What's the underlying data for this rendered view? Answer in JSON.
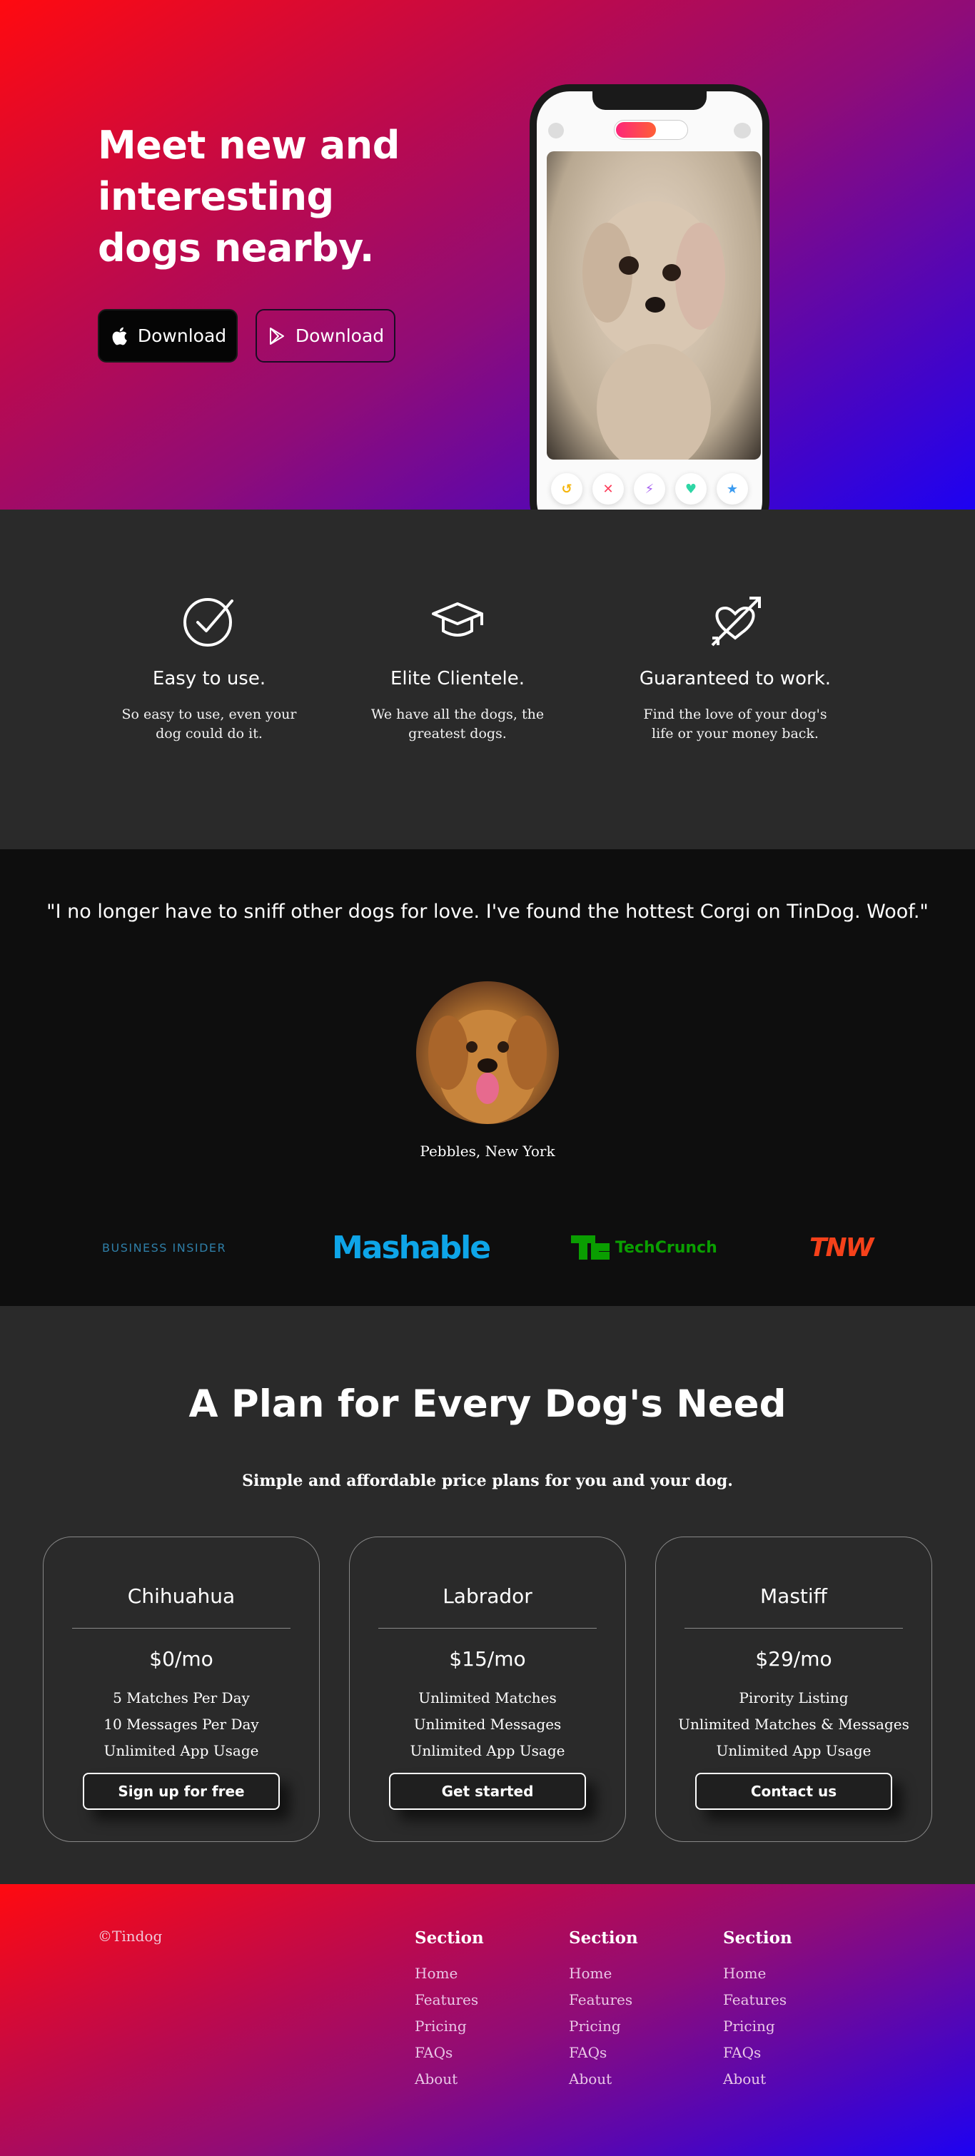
{
  "hero": {
    "title": "Meet new and interesting dogs nearby.",
    "apple_button": "Download",
    "google_button": "Download",
    "phone_buttons": [
      "↺",
      "✕",
      "⚡",
      "♥",
      "★"
    ],
    "phone_button_colors": [
      "#f5b50a",
      "#fd3c5a",
      "#a55ef0",
      "#2ed6a5",
      "#3b9bf0"
    ]
  },
  "features": [
    {
      "icon": "check-circle-icon",
      "title": "Easy to use.",
      "text": "So easy to use, even your dog could do it."
    },
    {
      "icon": "graduation-cap-icon",
      "title": "Elite Clientele.",
      "text": "We have all the dogs, the greatest dogs."
    },
    {
      "icon": "heart-arrow-icon",
      "title": "Guaranteed to work.",
      "text": "Find the love of your dog's life or your money back."
    }
  ],
  "testimonial": {
    "quote": "\"I no longer have to sniff other dogs for love. I've found the hottest Corgi on TinDog. Woof.\"",
    "author": "Pebbles, New York"
  },
  "press": [
    {
      "name": "BUSINESS INSIDER",
      "color": "#2f7fa8"
    },
    {
      "name": "Mashable",
      "color": "#0ea5e8"
    },
    {
      "name": "TechCrunch",
      "color": "#0a9e01"
    },
    {
      "name": "TNW",
      "color": "#f5411a"
    }
  ],
  "pricing": {
    "title": "A Plan for Every Dog's Need",
    "subtitle": "Simple and affordable price plans for you and your dog.",
    "plans": [
      {
        "name": "Chihuahua",
        "price": "$0/mo",
        "features": [
          "5 Matches Per Day",
          "10 Messages Per Day",
          "Unlimited App Usage"
        ],
        "cta": "Sign up for free"
      },
      {
        "name": "Labrador",
        "price": "$15/mo",
        "features": [
          "Unlimited Matches",
          "Unlimited Messages",
          "Unlimited App Usage"
        ],
        "cta": "Get started"
      },
      {
        "name": "Mastiff",
        "price": "$29/mo",
        "features": [
          "Pirority Listing",
          "Unlimited Matches & Messages",
          "Unlimited App Usage"
        ],
        "cta": "Contact us"
      }
    ]
  },
  "footer": {
    "copyright": "©Tindog",
    "columns": [
      {
        "heading": "Section",
        "links": [
          "Home",
          "Features",
          "Pricing",
          "FAQs",
          "About"
        ]
      },
      {
        "heading": "Section",
        "links": [
          "Home",
          "Features",
          "Pricing",
          "FAQs",
          "About"
        ]
      },
      {
        "heading": "Section",
        "links": [
          "Home",
          "Features",
          "Pricing",
          "FAQs",
          "About"
        ]
      }
    ]
  }
}
